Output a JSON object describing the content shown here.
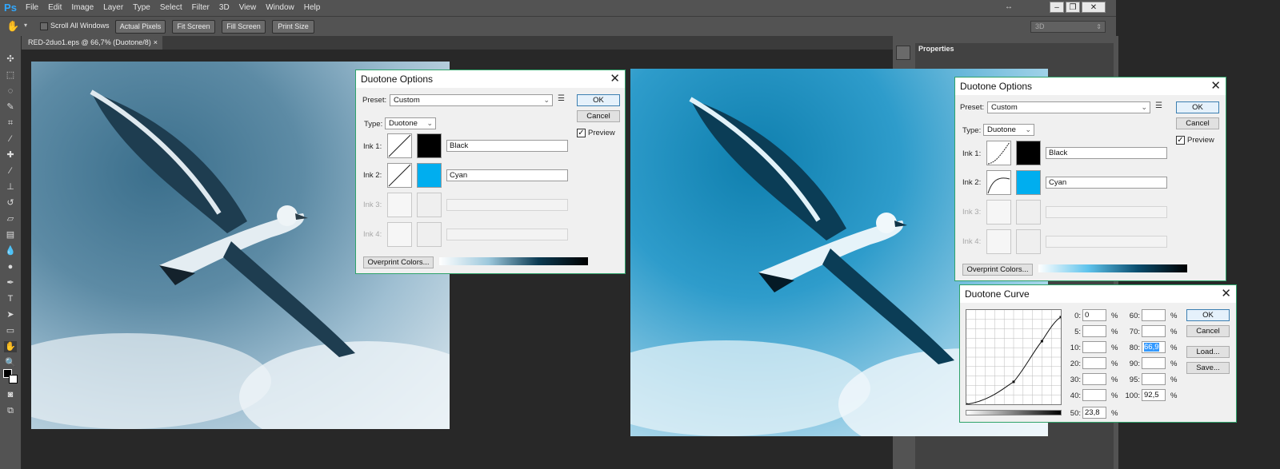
{
  "app": {
    "logo": "Ps"
  },
  "menu": [
    "File",
    "Edit",
    "Image",
    "Layer",
    "Type",
    "Select",
    "Filter",
    "3D",
    "View",
    "Window",
    "Help"
  ],
  "window_controls": {
    "minimize": "‒",
    "restore": "❐",
    "close": "✕"
  },
  "options": {
    "scroll_all_label": "Scroll All Windows",
    "actual_pixels": "Actual Pixels",
    "fit_screen": "Fit Screen",
    "fill_screen": "Fill Screen",
    "print_size": "Print Size",
    "workspace": "3D"
  },
  "document_tab": {
    "title": "RED-2duo1.eps @ 66,7% (Duotone/8)",
    "close": "×"
  },
  "panel": {
    "title": "Properties"
  },
  "dialog_left": {
    "title": "Duotone Options",
    "preset_label": "Preset:",
    "preset_value": "Custom",
    "type_label": "Type:",
    "type_value": "Duotone",
    "ok": "OK",
    "cancel": "Cancel",
    "preview_label": "Preview",
    "inks": [
      {
        "label": "Ink 1:",
        "name": "Black",
        "color": "#000000"
      },
      {
        "label": "Ink 2:",
        "name": "Cyan",
        "color": "#00aeef"
      },
      {
        "label": "Ink 3:",
        "name": ""
      },
      {
        "label": "Ink 4:",
        "name": ""
      }
    ],
    "overprint": "Overprint Colors..."
  },
  "dialog_right": {
    "title": "Duotone Options",
    "preset_label": "Preset:",
    "preset_value": "Custom",
    "type_label": "Type:",
    "type_value": "Duotone",
    "ok": "OK",
    "cancel": "Cancel",
    "preview_label": "Preview",
    "inks": [
      {
        "label": "Ink 1:",
        "name": "Black",
        "color": "#000000"
      },
      {
        "label": "Ink 2:",
        "name": "Cyan",
        "color": "#00aeef"
      },
      {
        "label": "Ink 3:",
        "name": ""
      },
      {
        "label": "Ink 4:",
        "name": ""
      }
    ],
    "overprint": "Overprint Colors..."
  },
  "curve_dialog": {
    "title": "Duotone Curve",
    "ok": "OK",
    "cancel": "Cancel",
    "load": "Load...",
    "save": "Save...",
    "pct": "%",
    "left_column": [
      {
        "label": "0:",
        "value": "0"
      },
      {
        "label": "5:",
        "value": ""
      },
      {
        "label": "10:",
        "value": ""
      },
      {
        "label": "20:",
        "value": ""
      },
      {
        "label": "30:",
        "value": ""
      },
      {
        "label": "40:",
        "value": ""
      },
      {
        "label": "50:",
        "value": "23,8"
      }
    ],
    "right_column": [
      {
        "label": "60:",
        "value": ""
      },
      {
        "label": "70:",
        "value": ""
      },
      {
        "label": "80:",
        "value": "66,9"
      },
      {
        "label": "90:",
        "value": ""
      },
      {
        "label": "95:",
        "value": ""
      },
      {
        "label": "100:",
        "value": "92,5"
      }
    ]
  }
}
